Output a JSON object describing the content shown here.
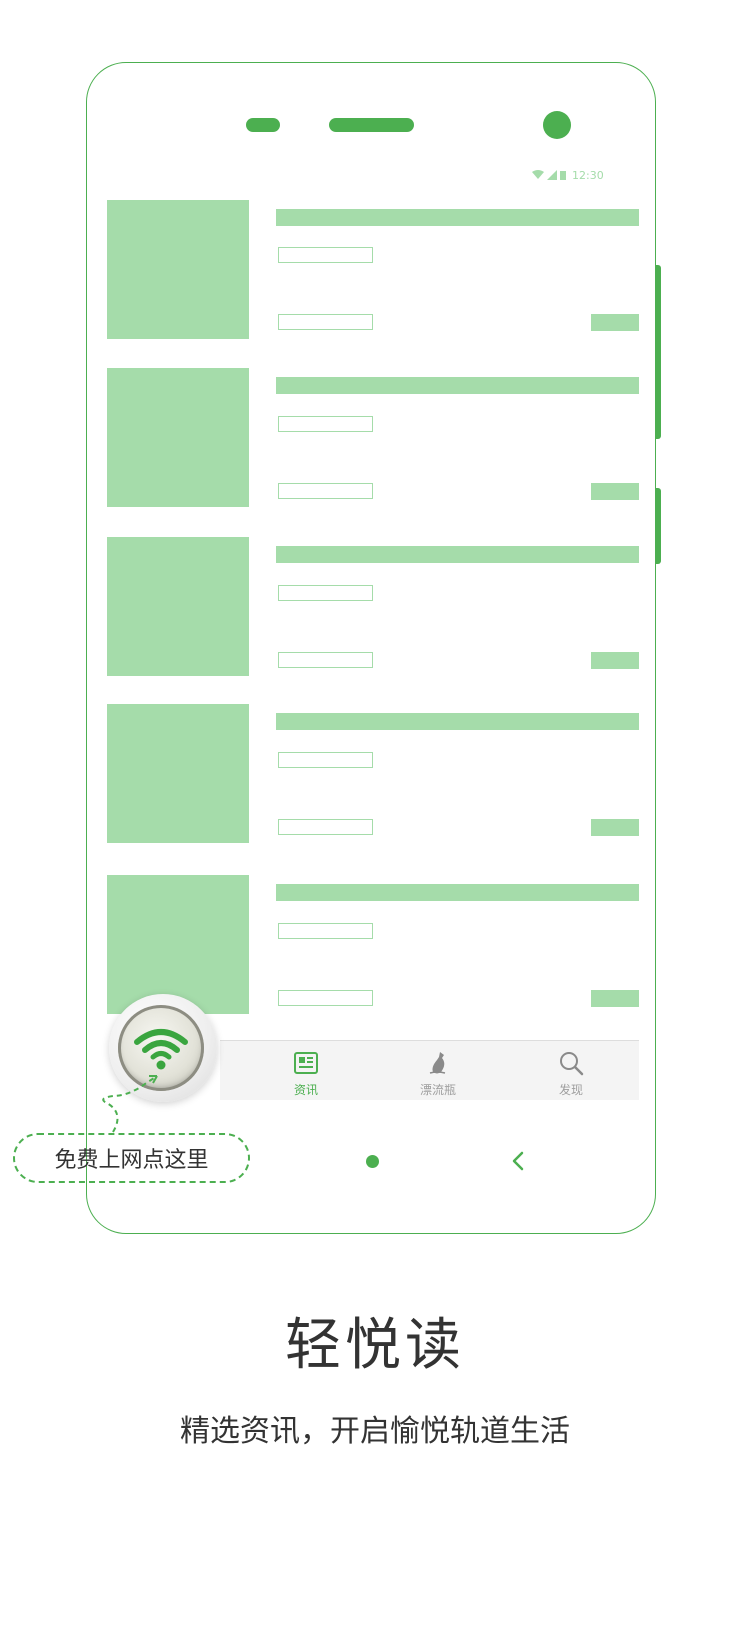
{
  "status_bar": {
    "time": "12:30"
  },
  "tabs": [
    {
      "label": "资讯",
      "icon": "newspaper-icon",
      "active": true
    },
    {
      "label": "漂流瓶",
      "icon": "bottle-icon",
      "active": false
    },
    {
      "label": "发现",
      "icon": "search-icon",
      "active": false
    }
  ],
  "fab": {
    "icon": "wifi-icon"
  },
  "callout": {
    "text": "免费上网点这里"
  },
  "headline": "轻悦读",
  "subline": "精选资讯，开启愉悦轨道生活",
  "colors": {
    "accent": "#4caf50",
    "placeholder": "#a5dcaa",
    "text": "#333333"
  }
}
